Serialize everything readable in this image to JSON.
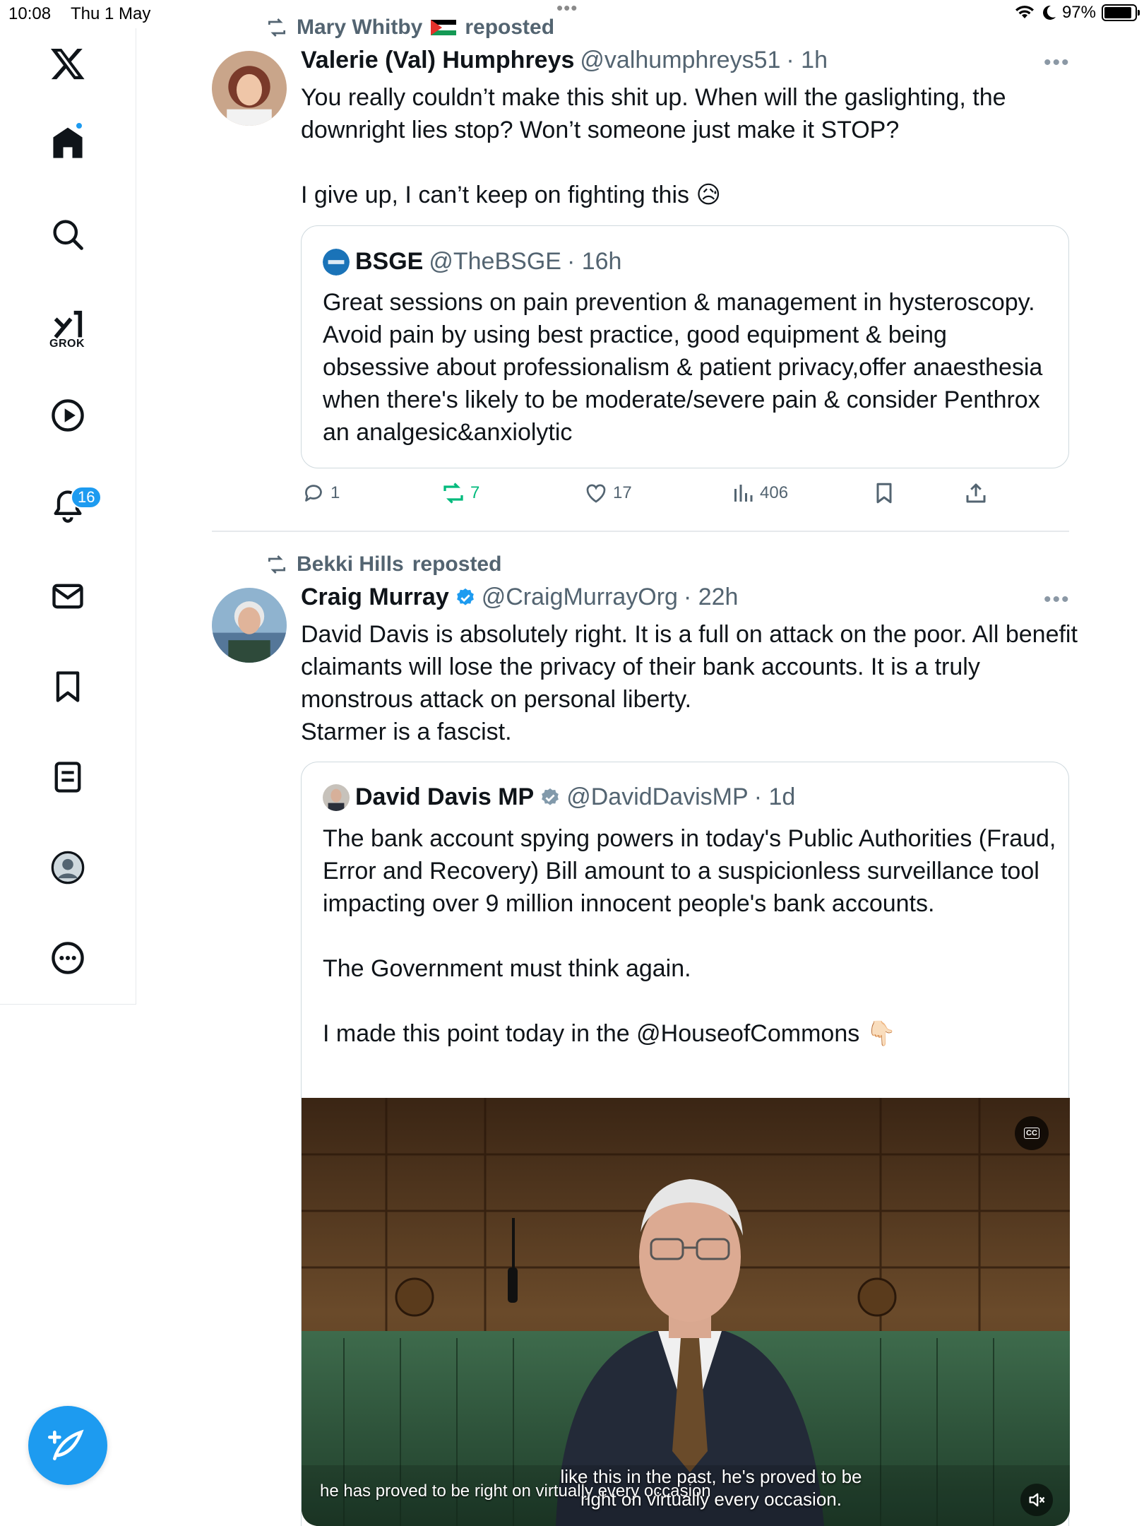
{
  "status_bar": {
    "time": "10:08",
    "date": "Thu 1 May",
    "dots": "•••",
    "battery_pct": "97%",
    "battery_level": 0.97
  },
  "sidebar": {
    "items": [
      {
        "name": "x-logo",
        "icon": "x-logo"
      },
      {
        "name": "home",
        "icon": "home-icon",
        "has_dot": true
      },
      {
        "name": "search",
        "icon": "search-icon"
      },
      {
        "name": "grok",
        "icon": "grok-icon",
        "label": "GROK"
      },
      {
        "name": "video",
        "icon": "play-icon"
      },
      {
        "name": "notifications",
        "icon": "bell-icon",
        "badge": "16"
      },
      {
        "name": "messages",
        "icon": "envelope-icon"
      },
      {
        "name": "bookmarks",
        "icon": "bookmark-icon"
      },
      {
        "name": "lists",
        "icon": "list-icon"
      },
      {
        "name": "profile",
        "icon": "profile-icon"
      },
      {
        "name": "more",
        "icon": "more-circle-icon"
      }
    ],
    "compose_icon": "compose-icon"
  },
  "colors": {
    "accent": "#1d9bf0",
    "text_primary": "#0f1419",
    "text_secondary": "#536471",
    "repost_green": "#00ba7c",
    "border": "#cfd9de"
  },
  "posts": [
    {
      "repost_by": "Mary Whitby",
      "repost_suffix": "reposted",
      "author_name": "Valerie (Val) Humphreys",
      "author_handle": "@valhumphreys51",
      "time": "· 1h",
      "more": "•••",
      "text_lines": [
        "You really couldn’t make this shit up. When will the gaslighting, the",
        "downright lies stop? Won’t someone just make it STOP?"
      ],
      "text_line3": "I give up, I can’t keep on fighting this 😥",
      "quote": {
        "author_name": "BSGE",
        "author_handle": "@TheBSGE",
        "time": "· 16h",
        "avatar_text": "BSGE",
        "text": "Great sessions on pain prevention & management in hysteroscopy. Avoid pain by using best practice, good equipment & being obsessive about professionalism & patient privacy,offer anaesthesia when there's likely to be moderate/severe pain & consider Penthrox an analgesic&anxiolytic"
      },
      "actions": {
        "replies": "1",
        "reposts": "7",
        "likes": "17",
        "views": "406"
      }
    },
    {
      "repost_by": "Bekki Hills",
      "repost_suffix": "reposted",
      "author_name": "Craig Murray",
      "author_handle": "@CraigMurrayOrg",
      "time": "· 22h",
      "more": "•••",
      "text": "David Davis is absolutely right. It is a full on attack on the poor. All benefit claimants will lose the privacy of their bank accounts. It is a truly monstrous attack on personal liberty.",
      "text_line4": "Starmer is a fascist.",
      "quote": {
        "author_name": "David Davis MP",
        "author_handle": "@DavidDavisMP",
        "time": "· 1d",
        "text_p1": "The bank account spying powers in today's Public Authorities (Fraud, Error and Recovery) Bill amount to a suspicionless surveillance tool impacting over 9 million innocent people's bank accounts.",
        "text_p2": "The Government must think again.",
        "text_p3": "I made this point today in the @HouseofCommons 👇🏻",
        "video": {
          "cc_label": "CC",
          "caption_small": "he has proved to be right on virtually every occasion",
          "caption_large_1": "like this in the past, he's proved to be",
          "caption_large_2": "right on virtually every occasion."
        }
      }
    }
  ]
}
